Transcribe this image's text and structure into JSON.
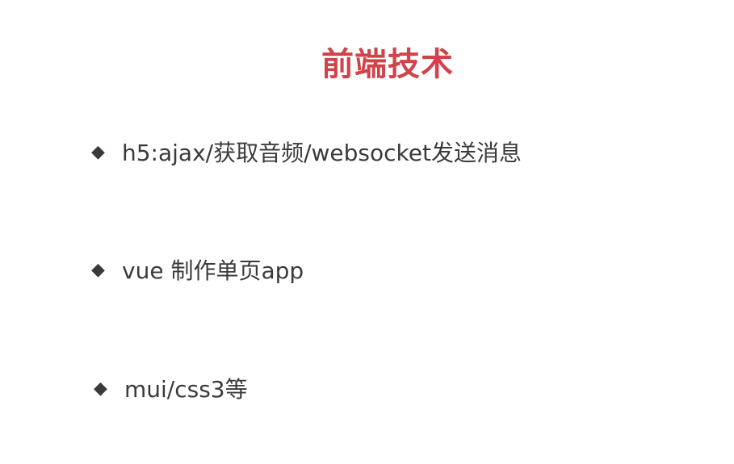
{
  "slide": {
    "title": "前端技术",
    "bullets": [
      {
        "marker": "◆",
        "text": "h5:ajax/获取音频/websocket发送消息"
      },
      {
        "marker": "◆",
        "text": "vue 制作单页app"
      },
      {
        "marker": "◆",
        "text": "mui/css3等"
      }
    ]
  },
  "colors": {
    "title": "#d0434a",
    "text": "#3a3a3a",
    "background": "#ffffff"
  }
}
